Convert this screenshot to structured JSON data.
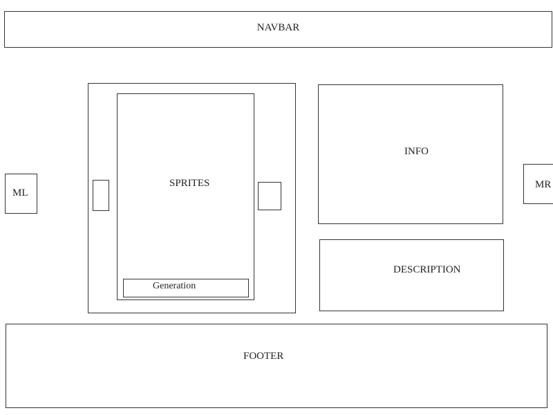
{
  "navbar": {
    "label": "NAVBAR"
  },
  "margin_left": {
    "label": "ML"
  },
  "margin_right": {
    "label": "MR"
  },
  "sprites": {
    "label": "SPRITES"
  },
  "generation": {
    "label": "Generation"
  },
  "info": {
    "label": "INFO"
  },
  "description": {
    "label": "DESCRIPTION"
  },
  "footer": {
    "label": "FOOTER"
  },
  "colors": {
    "border": "#333333",
    "background": "#ffffff",
    "text": "#222222"
  }
}
